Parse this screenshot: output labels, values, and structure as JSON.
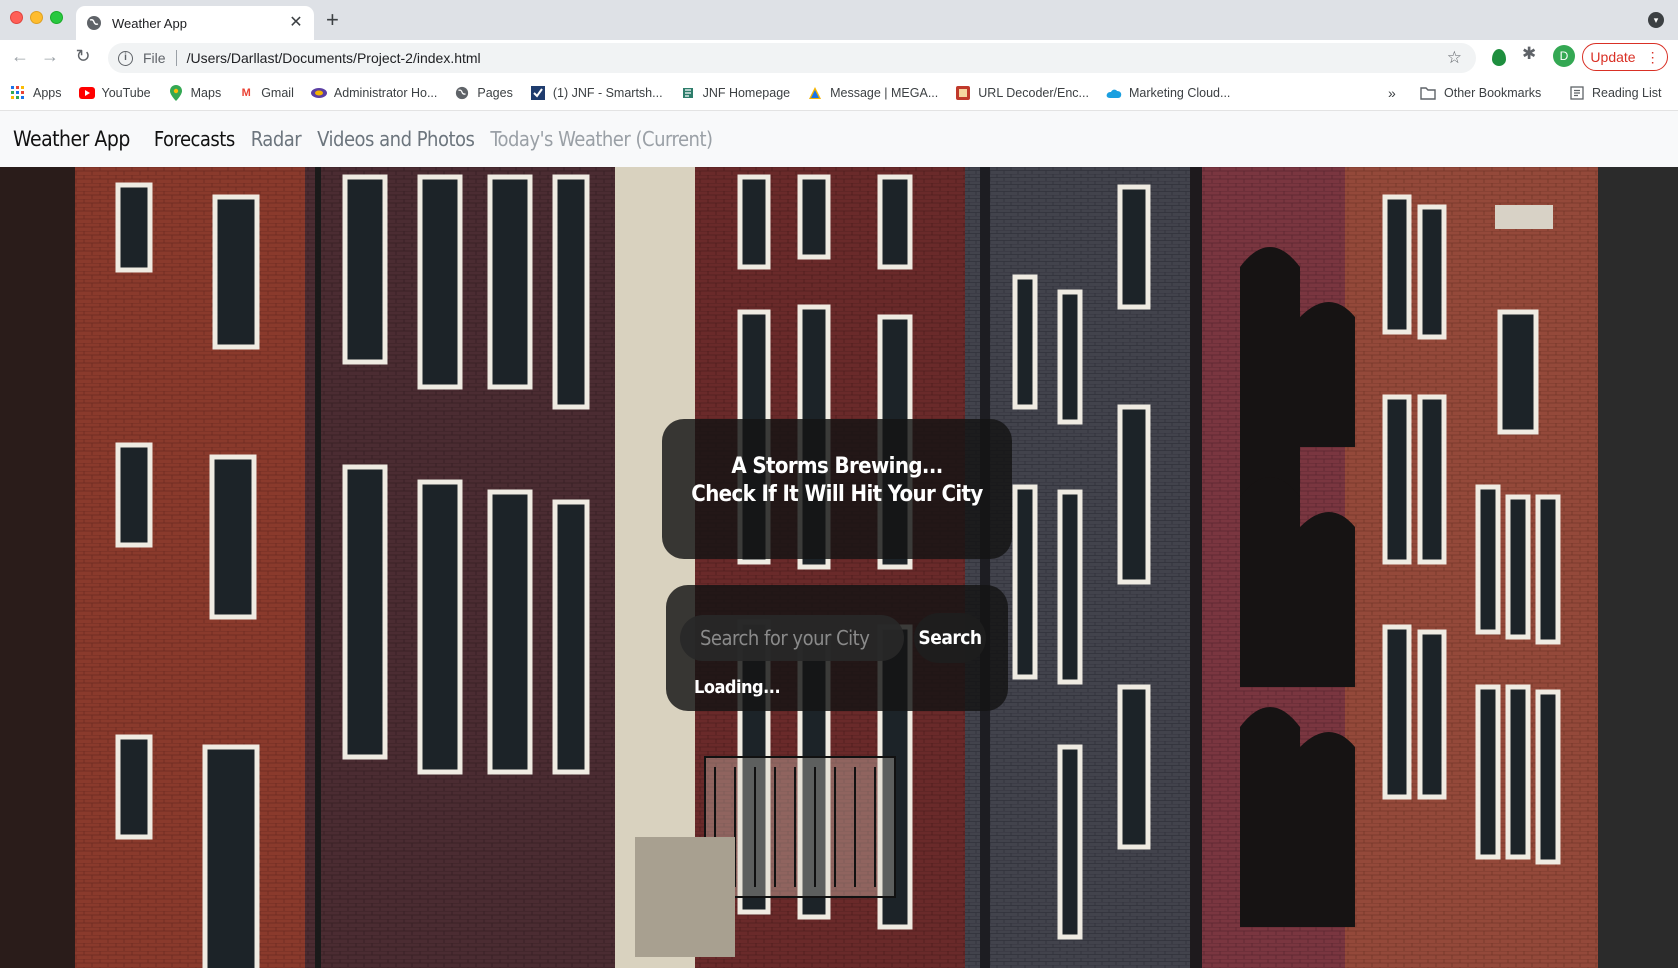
{
  "browser": {
    "tab_title": "Weather App",
    "url_scheme": "File",
    "url": "/Users/Darllast/Documents/Project-2/index.html",
    "avatar_letter": "D",
    "update_label": "Update"
  },
  "bookmarks": [
    {
      "label": "Apps",
      "icon": "apps-grid-icon"
    },
    {
      "label": "YouTube",
      "icon": "youtube-icon"
    },
    {
      "label": "Maps",
      "icon": "maps-pin-icon"
    },
    {
      "label": "Gmail",
      "icon": "gmail-icon"
    },
    {
      "label": "Administrator Ho...",
      "icon": "admin-icon"
    },
    {
      "label": "Pages",
      "icon": "globe-icon"
    },
    {
      "label": "(1) JNF - Smartsh...",
      "icon": "smartsheet-icon"
    },
    {
      "label": "JNF Homepage",
      "icon": "jnf-icon"
    },
    {
      "label": "Message | MEGA...",
      "icon": "mega-icon"
    },
    {
      "label": "URL Decoder/Enc...",
      "icon": "url-decoder-icon"
    },
    {
      "label": "Marketing Cloud...",
      "icon": "cloud-icon"
    }
  ],
  "bookmarks_right": {
    "more": "»",
    "other": "Other Bookmarks",
    "reading": "Reading List"
  },
  "appnav": {
    "brand": "Weather App",
    "links": [
      "Forecasts",
      "Radar",
      "Videos and Photos",
      "Today's Weather (Current)"
    ]
  },
  "hero": {
    "headline_line1": "A Storms Brewing...",
    "headline_line2": "Check If It Will Hit Your City",
    "search_placeholder": "Search for your City",
    "search_button": "Search",
    "status": "Loading..."
  },
  "colors": {
    "brick_red": "#8c3b2e",
    "purple_brick": "#4a2a30",
    "grey_brick": "#3e4048",
    "update_red": "#d93025"
  }
}
